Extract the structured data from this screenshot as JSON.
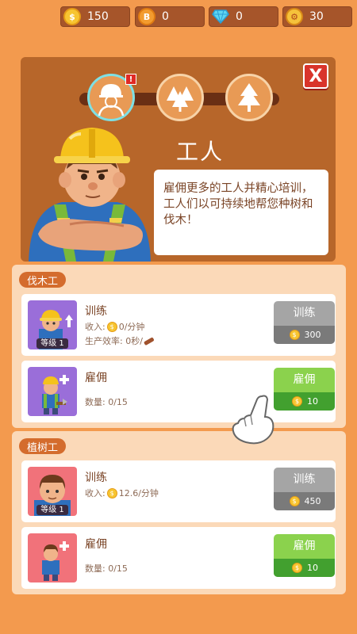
{
  "resources": [
    {
      "name": "coins",
      "value": "150",
      "icon": "coin-icon",
      "symbol": "$"
    },
    {
      "name": "bonus-coins",
      "value": "0",
      "icon": "bitcoin-icon",
      "symbol": "B"
    },
    {
      "name": "gems",
      "value": "0",
      "icon": "diamond-icon",
      "symbol": ""
    },
    {
      "name": "boost",
      "value": "30",
      "icon": "boost-icon",
      "symbol": "⚙"
    }
  ],
  "panel": {
    "title": "工人",
    "description": "雇佣更多的工人并精心培训，工人们以可持续地帮您种树和伐木！",
    "close_label": "X",
    "alert": "!"
  },
  "sections": [
    {
      "label": "伐木工",
      "train": {
        "title": "训练",
        "level": "等级 1",
        "income_prefix": "收入:",
        "income_value": "0/分钟",
        "efficiency": "生产效率: 0秒/",
        "button_label": "训练",
        "cost": "300"
      },
      "hire": {
        "title": "雇佣",
        "count": "数量: 0/15",
        "button_label": "雇佣",
        "cost": "10"
      }
    },
    {
      "label": "植树工",
      "train": {
        "title": "训练",
        "level": "等级 1",
        "income_prefix": "收入:",
        "income_value": "12.6/分钟",
        "button_label": "训练",
        "cost": "450"
      },
      "hire": {
        "title": "雇佣",
        "count": "数量: 0/15",
        "button_label": "雇佣",
        "cost": "10"
      }
    }
  ],
  "colors": {
    "background": "#f39a4e",
    "panel": "#b7662a",
    "button_gray": "#a5a5a5",
    "button_green": "#8bd24d"
  }
}
